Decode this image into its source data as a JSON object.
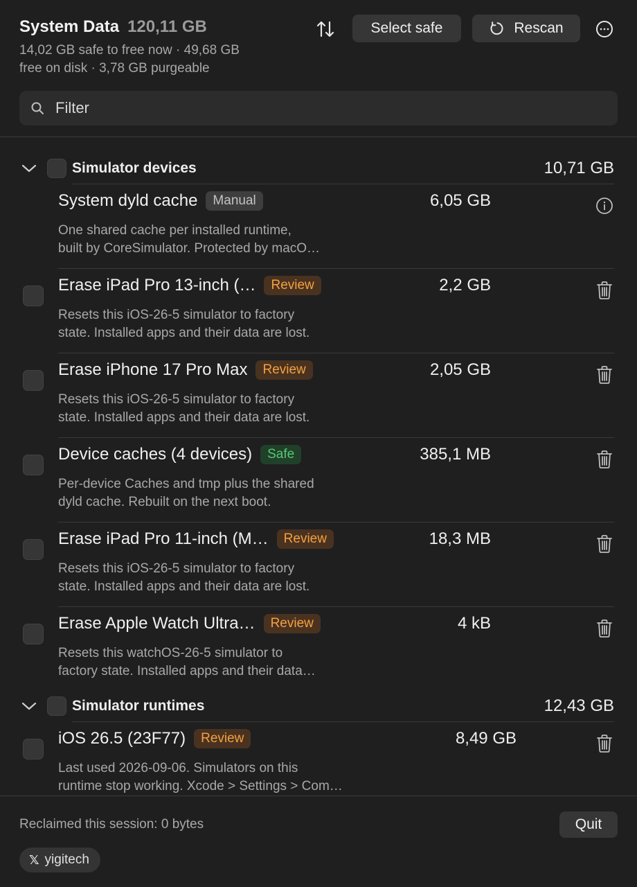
{
  "header": {
    "title": "System Data",
    "total_size": "120,11 GB",
    "subtitle_line1": "14,02 GB safe to free now · 49,68 GB",
    "subtitle_line2": "free on disk · 3,78 GB purgeable",
    "select_safe_label": "Select safe",
    "rescan_label": "Rescan"
  },
  "filter": {
    "placeholder": "Filter",
    "value": ""
  },
  "sections": [
    {
      "title": "Simulator devices",
      "size": "10,71 GB",
      "items": [
        {
          "title": "System dyld cache",
          "badge": "Manual",
          "size": "6,05 GB",
          "desc_line1": "One shared cache per installed runtime,",
          "desc_line2": "built by CoreSimulator. Protected by macO…",
          "action_icon": "info-icon"
        },
        {
          "title": "Erase iPad Pro 13-inch (…",
          "badge": "Review",
          "size": "2,2 GB",
          "desc_line1": "Resets this iOS-26-5 simulator to factory",
          "desc_line2": "state. Installed apps and their data are lost.",
          "action_icon": "trash-icon"
        },
        {
          "title": "Erase iPhone 17 Pro Max",
          "badge": "Review",
          "size": "2,05 GB",
          "desc_line1": "Resets this iOS-26-5 simulator to factory",
          "desc_line2": "state. Installed apps and their data are lost.",
          "action_icon": "trash-icon"
        },
        {
          "title": "Device caches (4 devices)",
          "badge": "Safe",
          "size": "385,1 MB",
          "desc_line1": "Per-device Caches and tmp plus the shared",
          "desc_line2": "dyld cache. Rebuilt on the next boot.",
          "action_icon": "trash-icon"
        },
        {
          "title": "Erase iPad Pro 11-inch (M…",
          "badge": "Review",
          "size": "18,3 MB",
          "desc_line1": "Resets this iOS-26-5 simulator to factory",
          "desc_line2": "state. Installed apps and their data are lost.",
          "action_icon": "trash-icon"
        },
        {
          "title": "Erase Apple Watch Ultra…",
          "badge": "Review",
          "size": "4 kB",
          "desc_line1": "Resets this watchOS-26-5 simulator to",
          "desc_line2": "factory state. Installed apps and their data…",
          "action_icon": "trash-icon"
        }
      ]
    },
    {
      "title": "Simulator runtimes",
      "size": "12,43 GB",
      "items": [
        {
          "title": "iOS 26.5 (23F77)",
          "badge": "Review",
          "size": "8,49 GB",
          "desc_line1": "Last used 2026-09-06. Simulators on this",
          "desc_line2": "runtime stop working. Xcode > Settings > Com…",
          "action_icon": "trash-icon"
        }
      ]
    }
  ],
  "footer": {
    "reclaimed": "Reclaimed this session: 0 bytes",
    "quit_label": "Quit",
    "x_logo": "𝕏",
    "x_handle": "yigitech"
  },
  "colors": {
    "background": "#1f1f1f",
    "review_badge_text": "#f4a140",
    "safe_badge_text": "#58c774",
    "manual_badge_text": "#c2c2c2"
  }
}
